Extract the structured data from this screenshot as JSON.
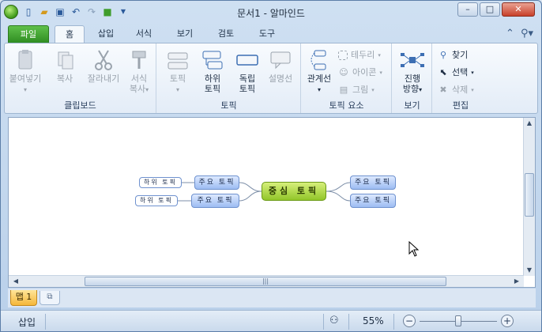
{
  "window": {
    "title": "문서1 - 알마인드",
    "controls": {
      "minimize": "–",
      "maximize": "□",
      "close": "✕"
    }
  },
  "quick_access": {
    "icons": [
      "new-doc-icon",
      "open-folder-icon",
      "save-icon",
      "undo-icon",
      "redo-icon",
      "theme-icon",
      "customize-icon"
    ]
  },
  "tabs": [
    {
      "label": "파일",
      "active": false
    },
    {
      "label": "홈",
      "active": true
    },
    {
      "label": "삽입",
      "active": false
    },
    {
      "label": "서식",
      "active": false
    },
    {
      "label": "보기",
      "active": false
    },
    {
      "label": "검토",
      "active": false
    },
    {
      "label": "도구",
      "active": false
    }
  ],
  "ribbon": {
    "clipboard": {
      "label": "클립보드",
      "paste": "붙여넣기",
      "copy": "복사",
      "cut": "잘라내기",
      "format_copy_1": "서식",
      "format_copy_2": "복사"
    },
    "topic": {
      "label": "토픽",
      "topic": "토픽",
      "sub_1": "하위",
      "sub_2": "토픽",
      "free_1": "독립",
      "free_2": "토픽",
      "callout": "설명선"
    },
    "topic_elements": {
      "label": "토픽 요소",
      "relation": "관계선",
      "border": "테두리",
      "icon": "아이콘",
      "image": "그림"
    },
    "view": {
      "label": "보기",
      "direction_1": "진행",
      "direction_2": "방향"
    },
    "edit": {
      "label": "편집",
      "find": "찾기",
      "select": "선택",
      "delete": "삭제"
    }
  },
  "mindmap": {
    "central": "중심 토픽",
    "main_left_1": "주요 토픽",
    "main_left_2": "주요 토픽",
    "main_right_1": "주요 토픽",
    "main_right_2": "주요 토픽",
    "sub_1": "하위 토픽",
    "sub_2": "하위 토픽"
  },
  "sheets": {
    "active": "맵 1"
  },
  "status": {
    "mode": "삽입",
    "zoom": "55%",
    "zoom_level_fraction": 0.5
  },
  "colors": {
    "file_tab": "#3f9d2c",
    "central_topic": "#a8d43c",
    "main_topic": "#b8cff5",
    "sheet_tab": "#f7c25a"
  }
}
